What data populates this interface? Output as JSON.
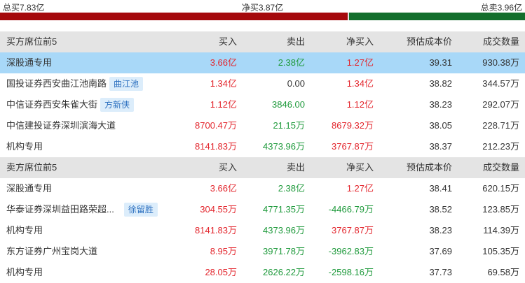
{
  "summary": {
    "buy_total": "总买7.83亿",
    "net_buy": "净买3.87亿",
    "sell_total": "总卖3.96亿",
    "buy_fraction": 0.664,
    "sell_fraction": 0.336
  },
  "colors": {
    "up": "#e3262d",
    "down": "#1f9a3c",
    "buy_bar": "#a5090c",
    "sell_bar": "#136e2c",
    "selected_row": "#a8d8f8"
  },
  "buy_section": {
    "headers": [
      "买方席位前5",
      "买入",
      "卖出",
      "净买入",
      "预估成本价",
      "成交数量"
    ],
    "rows": [
      {
        "seat": "深股通专用",
        "tag": "",
        "buy": "3.66亿",
        "sell": "2.38亿",
        "net": "1.27亿",
        "cost": "39.31",
        "volume": "930.38万",
        "selected": true,
        "net_dir": "up"
      },
      {
        "seat": "国投证券西安曲江池南路",
        "tag": "曲江池",
        "buy": "1.34亿",
        "sell": "0.00",
        "net": "1.34亿",
        "cost": "38.82",
        "volume": "344.57万",
        "selected": false,
        "net_dir": "up",
        "sell_dir": "flat"
      },
      {
        "seat": "中信证券西安朱雀大街",
        "tag": "方新侠",
        "buy": "1.12亿",
        "sell": "3846.00",
        "net": "1.12亿",
        "cost": "38.23",
        "volume": "292.07万",
        "selected": false,
        "net_dir": "up"
      },
      {
        "seat": "中信建投证券深圳滨海大道",
        "tag": "",
        "buy": "8700.47万",
        "sell": "21.15万",
        "net": "8679.32万",
        "cost": "38.05",
        "volume": "228.71万",
        "selected": false,
        "net_dir": "up"
      },
      {
        "seat": "机构专用",
        "tag": "",
        "buy": "8141.83万",
        "sell": "4373.96万",
        "net": "3767.87万",
        "cost": "38.37",
        "volume": "212.23万",
        "selected": false,
        "net_dir": "up"
      }
    ]
  },
  "sell_section": {
    "headers": [
      "卖方席位前5",
      "买入",
      "卖出",
      "净买入",
      "预估成本价",
      "成交数量"
    ],
    "rows": [
      {
        "seat": "深股通专用",
        "tag": "",
        "buy": "3.66亿",
        "sell": "2.38亿",
        "net": "1.27亿",
        "cost": "38.41",
        "volume": "620.15万",
        "selected": false,
        "net_dir": "up"
      },
      {
        "seat": "华泰证券深圳益田路荣超...",
        "tag": "徐留胜",
        "buy": "304.55万",
        "sell": "4771.35万",
        "net": "-4466.79万",
        "cost": "38.52",
        "volume": "123.85万",
        "selected": false,
        "net_dir": "down"
      },
      {
        "seat": "机构专用",
        "tag": "",
        "buy": "8141.83万",
        "sell": "4373.96万",
        "net": "3767.87万",
        "cost": "38.23",
        "volume": "114.39万",
        "selected": false,
        "net_dir": "up"
      },
      {
        "seat": "东方证券广州宝岗大道",
        "tag": "",
        "buy": "8.95万",
        "sell": "3971.78万",
        "net": "-3962.83万",
        "cost": "37.69",
        "volume": "105.35万",
        "selected": false,
        "net_dir": "down"
      },
      {
        "seat": "机构专用",
        "tag": "",
        "buy": "28.05万",
        "sell": "2626.22万",
        "net": "-2598.16万",
        "cost": "37.73",
        "volume": "69.58万",
        "selected": false,
        "net_dir": "down"
      }
    ]
  }
}
